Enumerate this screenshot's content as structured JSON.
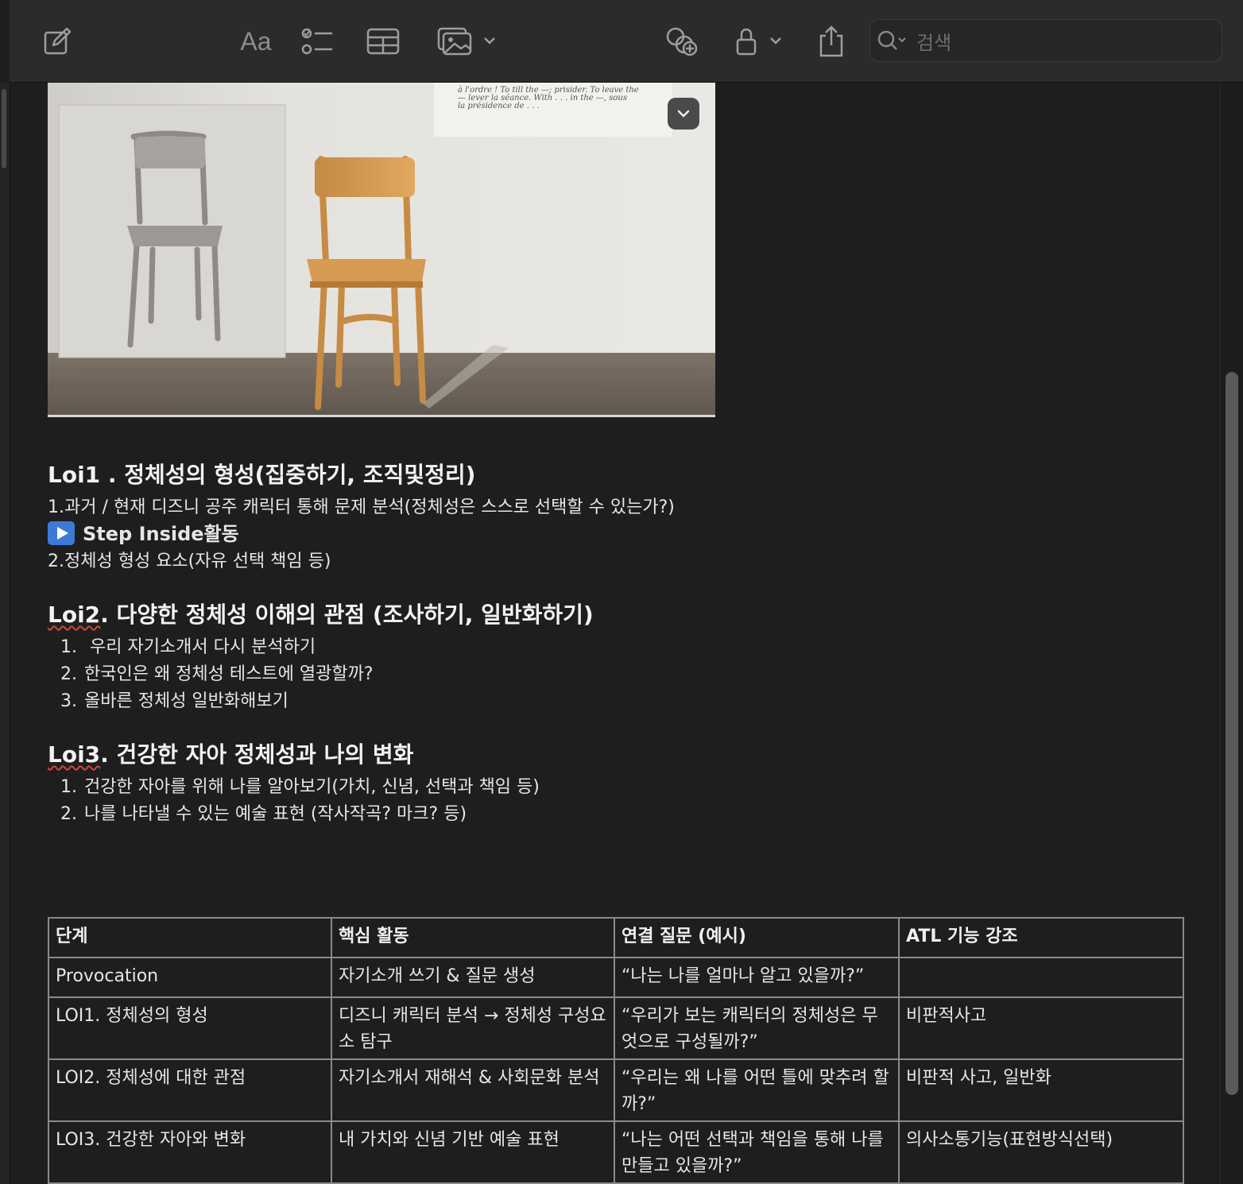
{
  "toolbar": {
    "format_label": "Aa",
    "search_placeholder": "검색"
  },
  "lois": {
    "loi1": {
      "heading": "Loi1 . 정체성의 형성(집중하기, 조직및정리)",
      "line1": "1.과거 / 현재 디즈니 공주 캐릭터 통해 문제 분석(정체성은 스스로 선택할 수 있는가?)",
      "step": "Step Inside활동",
      "line2": "2.정체성 형성 요소(자유 선택 책임 등)"
    },
    "loi2": {
      "heading_prefix": "Loi2",
      "heading_rest": ". 다양한 정체성 이해의 관점 (조사하기, 일반화하기)",
      "items": [
        {
          "num": "1.",
          "text": " 우리 자기소개서 다시 분석하기"
        },
        {
          "num": "2.",
          "text": "한국인은 왜 정체성 테스트에 열광할까?"
        },
        {
          "num": "3.",
          "text": "올바른 정체성 일반화해보기"
        }
      ]
    },
    "loi3": {
      "heading_prefix": "Loi3",
      "heading_rest": ". 건강한 자아 정체성과 나의 변화",
      "items": [
        {
          "num": "1.",
          "text": "건강한 자아를 위해 나를 알아보기(가치, 신념, 선택과 책임 등)"
        },
        {
          "num": "2.",
          "text": "나를 나타낼 수 있는 예술 표현 (작사작곡? 마크? 등)"
        }
      ]
    }
  },
  "table": {
    "headers": [
      "단계",
      "핵심 활동",
      "연결 질문 (예시)",
      "ATL 기능 강조"
    ],
    "rows": [
      [
        "Provocation",
        "자기소개 쓰기 & 질문 생성",
        "“나는 나를 얼마나 알고 있을까?”",
        ""
      ],
      [
        "LOI1. 정체성의 형성",
        "디즈니 캐릭터 분석 → 정체성 구성요소 탐구",
        "“우리가 보는 캐릭터의 정체성은 무엇으로 구성될까?”",
        "비판적사고"
      ],
      [
        "LOI2. 정체성에 대한 관점",
        "자기소개서 재해석 & 사회문화 분석",
        "“우리는 왜 나를 어떤 틀에 맞추려 할까?”",
        "비판적 사고, 일반화"
      ],
      [
        "LOI3. 건강한 자아와 변화",
        "내 가치와 신념 기반 예술 표현",
        "“나는 어떤 선택과 책임을 통해 나를 만들고 있을까?”",
        "의사소통기능(표현방식선택)"
      ]
    ]
  },
  "photo": {
    "caption_lines": [
      "à l'ordre ! To till the —; prisider.  To leave the",
      "— lever la séance.  With . . . in the —, sous",
      "la présidence de . . ."
    ]
  }
}
